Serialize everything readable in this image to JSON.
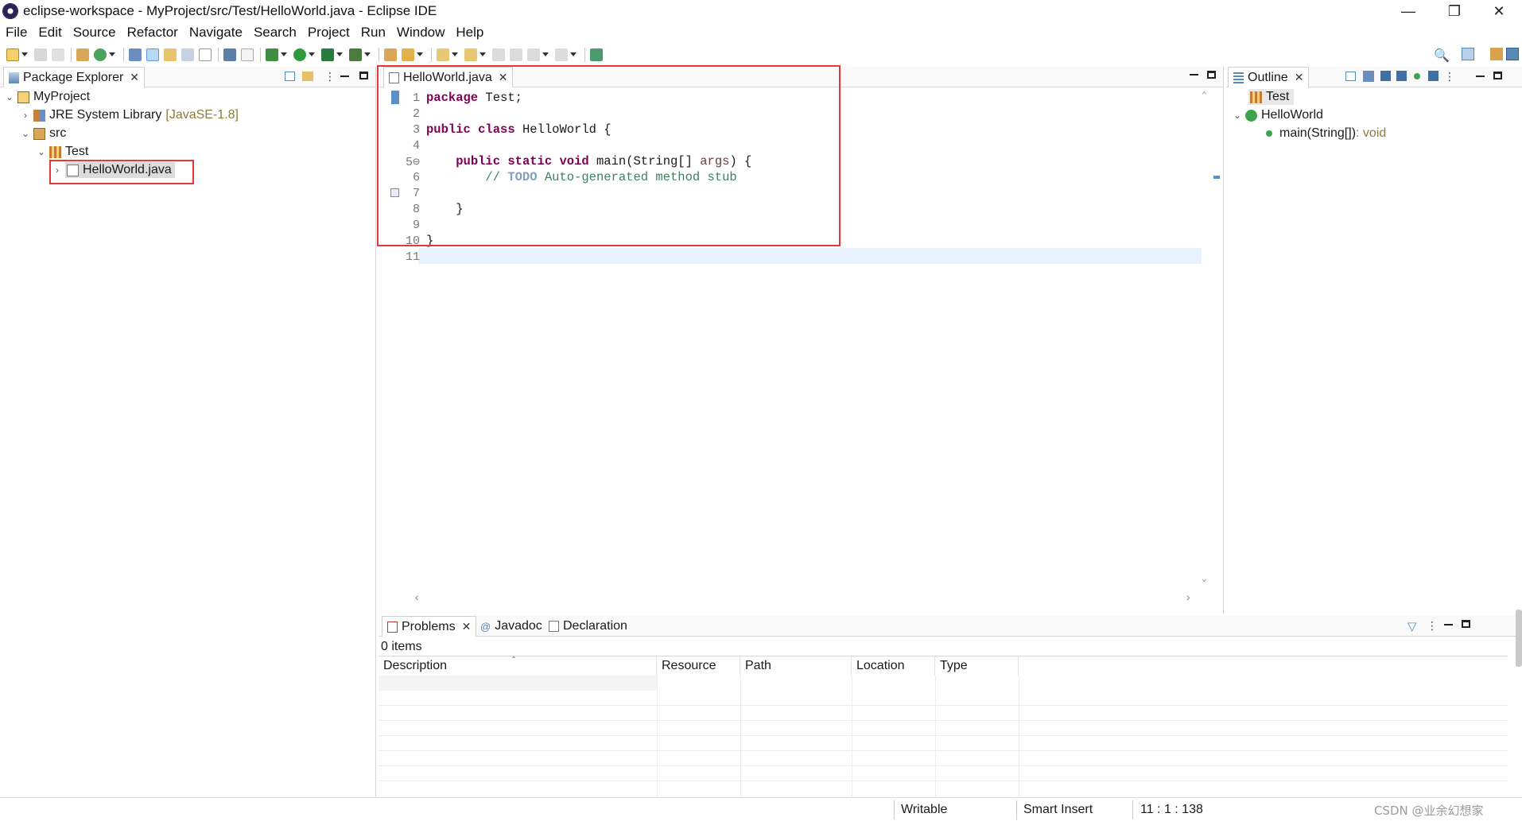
{
  "window": {
    "title": "eclipse-workspace - MyProject/src/Test/HelloWorld.java - Eclipse IDE",
    "controls": [
      "minimize",
      "restore",
      "close"
    ]
  },
  "menu": [
    "File",
    "Edit",
    "Source",
    "Refactor",
    "Navigate",
    "Search",
    "Project",
    "Run",
    "Window",
    "Help"
  ],
  "package_explorer": {
    "tab_label": "Package Explorer",
    "tree": [
      {
        "label": "MyProject",
        "expanded": true,
        "icon": "project-folder-icon"
      },
      {
        "label": "JRE System Library",
        "decoration": "[JavaSE-1.8]",
        "expanded": false,
        "icon": "library-icon"
      },
      {
        "label": "src",
        "expanded": true,
        "icon": "source-folder-icon"
      },
      {
        "label": "Test",
        "expanded": true,
        "icon": "package-icon"
      },
      {
        "label": "HelloWorld.java",
        "expanded": false,
        "icon": "java-file-icon",
        "selected": true
      }
    ]
  },
  "editor": {
    "tab_label": "HelloWorld.java",
    "lines": [
      {
        "num": "1",
        "tokens": [
          {
            "t": "package",
            "c": "kw"
          },
          {
            "t": " Test;",
            "c": ""
          }
        ]
      },
      {
        "num": "2",
        "tokens": []
      },
      {
        "num": "3",
        "tokens": [
          {
            "t": "public",
            "c": "kw"
          },
          {
            "t": " ",
            "c": ""
          },
          {
            "t": "class",
            "c": "kw"
          },
          {
            "t": " HelloWorld {",
            "c": ""
          }
        ]
      },
      {
        "num": "4",
        "tokens": []
      },
      {
        "num": "5⊖",
        "tokens": [
          {
            "t": "    ",
            "c": ""
          },
          {
            "t": "public",
            "c": "kw"
          },
          {
            "t": " ",
            "c": ""
          },
          {
            "t": "static",
            "c": "kw"
          },
          {
            "t": " ",
            "c": ""
          },
          {
            "t": "void",
            "c": "kw"
          },
          {
            "t": " main(String[] ",
            "c": ""
          },
          {
            "t": "args",
            "c": "param"
          },
          {
            "t": ") {",
            "c": ""
          }
        ]
      },
      {
        "num": "6",
        "tokens": [
          {
            "t": "        // ",
            "c": "cm"
          },
          {
            "t": "TODO",
            "c": "todo"
          },
          {
            "t": " Auto-generated method stub",
            "c": "cm"
          }
        ]
      },
      {
        "num": "7",
        "tokens": []
      },
      {
        "num": "8",
        "tokens": [
          {
            "t": "    }",
            "c": ""
          }
        ]
      },
      {
        "num": "9",
        "tokens": []
      },
      {
        "num": "10",
        "tokens": [
          {
            "t": "}",
            "c": ""
          }
        ]
      },
      {
        "num": "11",
        "tokens": []
      }
    ],
    "current_line": 11
  },
  "outline": {
    "tab_label": "Outline",
    "items": [
      {
        "label": "Test",
        "detail": "",
        "icon": "package-icon"
      },
      {
        "label": "HelloWorld",
        "detail": "",
        "icon": "class-icon"
      },
      {
        "label": "main(String[])",
        "detail": " : void",
        "icon": "method-icon"
      }
    ]
  },
  "bottom_panel": {
    "tabs": [
      "Problems",
      "Javadoc",
      "Declaration"
    ],
    "item_count": "0 items",
    "columns": [
      "Description",
      "Resource",
      "Path",
      "Location",
      "Type"
    ]
  },
  "status_bar": {
    "writable": "Writable",
    "insert_mode": "Smart Insert",
    "position": "11 : 1 : 138"
  },
  "watermark": "CSDN @业余幻想家",
  "colors": {
    "highlight_box": "#e53935",
    "keyword": "#7f0055",
    "comment": "#3f7f5f",
    "current_line": "#e8f2fe",
    "selection": "#dcdcdc"
  }
}
